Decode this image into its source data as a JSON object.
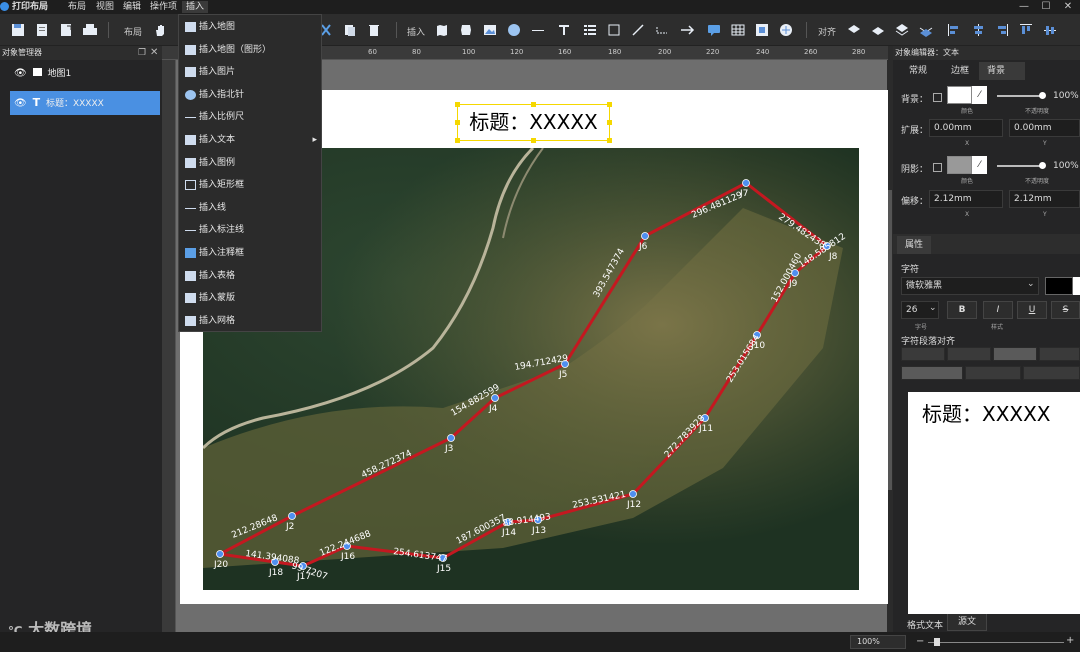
{
  "app": {
    "title": "打印布局"
  },
  "menu": [
    "布局",
    "视图",
    "编辑",
    "操作项",
    "插入"
  ],
  "toolbar": {
    "layout_label": "布局",
    "insert_label": "插入",
    "align_label": "对齐"
  },
  "object_manager": {
    "title": "对象管理器",
    "items": [
      {
        "label": "地图1"
      },
      {
        "label": "标题：XXXXX"
      }
    ]
  },
  "ruler": {
    "h_ticks": [
      "60",
      "80",
      "100",
      "120",
      "140",
      "160",
      "180",
      "200",
      "220",
      "240",
      "260",
      "280"
    ]
  },
  "insert_menu": {
    "items": [
      {
        "label": "插入地图",
        "icon": "map-icon"
      },
      {
        "label": "插入地图（图形）",
        "icon": "map-shape-icon"
      },
      {
        "label": "插入图片",
        "icon": "image-icon"
      },
      {
        "label": "插入指北针",
        "icon": "compass-icon"
      },
      {
        "label": "插入比例尺",
        "icon": "scalebar-icon"
      },
      {
        "label": "插入文本",
        "icon": "text-icon",
        "submenu": true
      },
      {
        "label": "插入图例",
        "icon": "legend-icon"
      },
      {
        "label": "插入矩形框",
        "icon": "rect-icon"
      },
      {
        "label": "插入线",
        "icon": "line-icon"
      },
      {
        "label": "插入标注线",
        "icon": "callout-line-icon"
      },
      {
        "label": "插入注释框",
        "icon": "comment-icon"
      },
      {
        "label": "插入表格",
        "icon": "table-icon"
      },
      {
        "label": "插入蒙版",
        "icon": "mask-icon"
      },
      {
        "label": "插入网格",
        "icon": "grid-icon"
      }
    ]
  },
  "map_title": "标题：XXXXX",
  "map_labels": [
    {
      "name": "J7"
    },
    {
      "name": "J6"
    },
    {
      "name": "J8"
    },
    {
      "name": "J9"
    },
    {
      "name": "J10"
    },
    {
      "name": "J11"
    },
    {
      "name": "J12"
    },
    {
      "name": "J13"
    },
    {
      "name": "J14"
    },
    {
      "name": "J15"
    },
    {
      "name": "J16"
    },
    {
      "name": "J17"
    },
    {
      "name": "J18"
    },
    {
      "name": "J20"
    },
    {
      "name": "J2"
    },
    {
      "name": "J3"
    },
    {
      "name": "J4"
    },
    {
      "name": "J5"
    }
  ],
  "segment_labels": [
    "296.481129",
    "279.482438",
    "148.585812",
    "152.000460",
    "253.015684",
    "272.783928",
    "253.531421",
    "88.914493",
    "187.600357",
    "254.613747",
    "122.244688",
    "99.7207",
    "141.394088",
    "212.28648",
    "458.272374",
    "154.882599",
    "194.712429",
    "393.547374"
  ],
  "editor": {
    "title": "对象编辑器：文本",
    "tabs": [
      "常规",
      "边框",
      "背景"
    ],
    "bg_label": "背景：",
    "color_sub": "颜色",
    "opacity_sub": "不透明度",
    "opacity_value": "100%",
    "expand_label": "扩展：",
    "expand_x": "0.00mm",
    "expand_y": "0.00mm",
    "x_sub": "X",
    "y_sub": "Y",
    "shadow_label": "阴影：",
    "shadow_opacity": "100%",
    "offset_label": "偏移：",
    "offset_x": "2.12mm",
    "offset_y": "2.12mm",
    "props_tab": "属性",
    "font_section": "字符",
    "font_name": "微软雅黑",
    "font_size": "26",
    "size_sub": "字号",
    "style_sub": "样式",
    "para_section": "字符段落对齐",
    "preview_text": "标题：XXXXX",
    "bottom_tabs": [
      "格式文本",
      "源文"
    ]
  },
  "status": {
    "zoom": "100%"
  },
  "watermark": "大数跨境"
}
